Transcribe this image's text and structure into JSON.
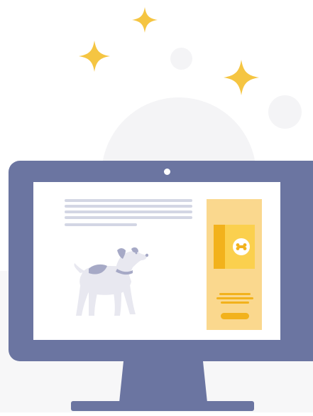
{
  "palette": {
    "monitor": "#6b75a1",
    "screen": "#ffffff",
    "floor": "#f7f7f8",
    "background_shapes": "#f4f4f6",
    "sparkle": "#f5c542",
    "text_lines": "#d3d6e4",
    "panel": "#fad88e",
    "box_dark": "#f2b21c",
    "box_light": "#fbd04e",
    "dog": "#e8e8f0",
    "dog_patch": "#a6a9c6"
  },
  "illustration": {
    "subject": "dog-on-screen",
    "icons": [
      "sparkle-icon",
      "bone-icon",
      "dog-icon"
    ]
  }
}
